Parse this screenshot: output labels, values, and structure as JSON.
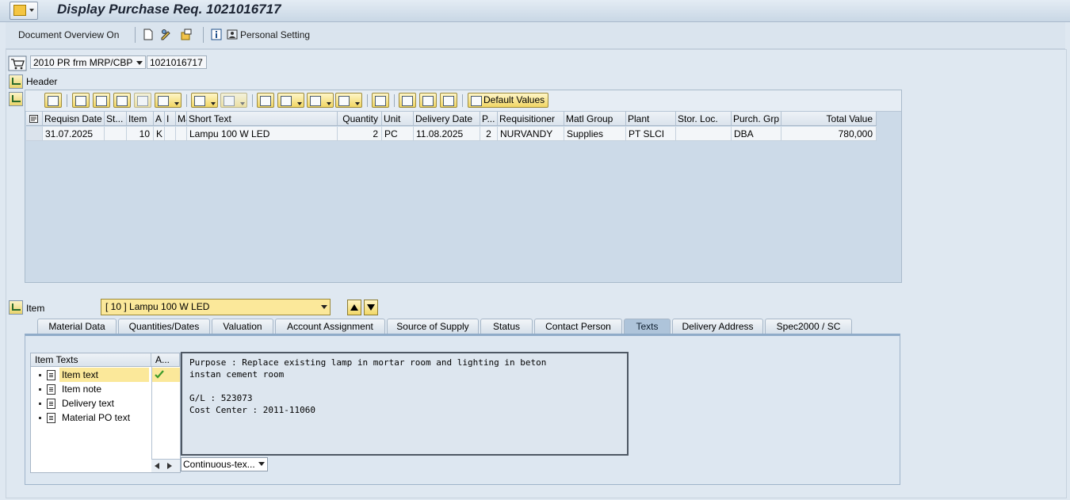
{
  "window": {
    "title": "Display Purchase Req. 1021016717"
  },
  "toolbar": {
    "doc_overview": "Document Overview On",
    "personal_setting": "Personal Setting"
  },
  "header_area": {
    "doc_type": "2010 PR frm MRP/CBP",
    "pr_number": "1021016717",
    "header_label": "Header"
  },
  "grid_toolbar": {
    "default_values": "Default Values"
  },
  "table": {
    "columns": [
      "Requisn Date",
      "St...",
      "Item",
      "A",
      "I",
      "Ma",
      "Short Text",
      "Quantity",
      "Unit",
      "Delivery Date",
      "P...",
      "Requisitioner",
      "Matl Group",
      "Plant",
      "Stor. Loc.",
      "Purch. Grp",
      "Total Value"
    ],
    "rows": [
      [
        "31.07.2025",
        "",
        "10",
        "K",
        "",
        "",
        "Lampu 100 W LED",
        "2",
        "PC",
        "11.08.2025",
        "2",
        "NURVANDY",
        "Supplies",
        "PT SLCI",
        "",
        "DBA",
        "780,000"
      ]
    ]
  },
  "item_section": {
    "label": "Item",
    "selected": "[ 10 ] Lampu 100 W LED"
  },
  "tabs": [
    "Material Data",
    "Quantities/Dates",
    "Valuation",
    "Account Assignment",
    "Source of Supply",
    "Status",
    "Contact Person",
    "Texts",
    "Delivery Address",
    "Spec2000 / SC"
  ],
  "active_tab": "Texts",
  "texts": {
    "tree_header": "Item Texts",
    "active_col_header": "A...",
    "items": [
      "Item text",
      "Item note",
      "Delivery text",
      "Material PO text"
    ],
    "content": "Purpose : Replace existing lamp in mortar room and lighting in beton\ninstan cement room\n\nG/L : 523073\nCost Center : 2011-11060",
    "format": "Continuous-tex..."
  },
  "colors": {
    "selected_row": "#fbe89a",
    "accent": "#aec4da",
    "check": "#3c9a2a"
  }
}
